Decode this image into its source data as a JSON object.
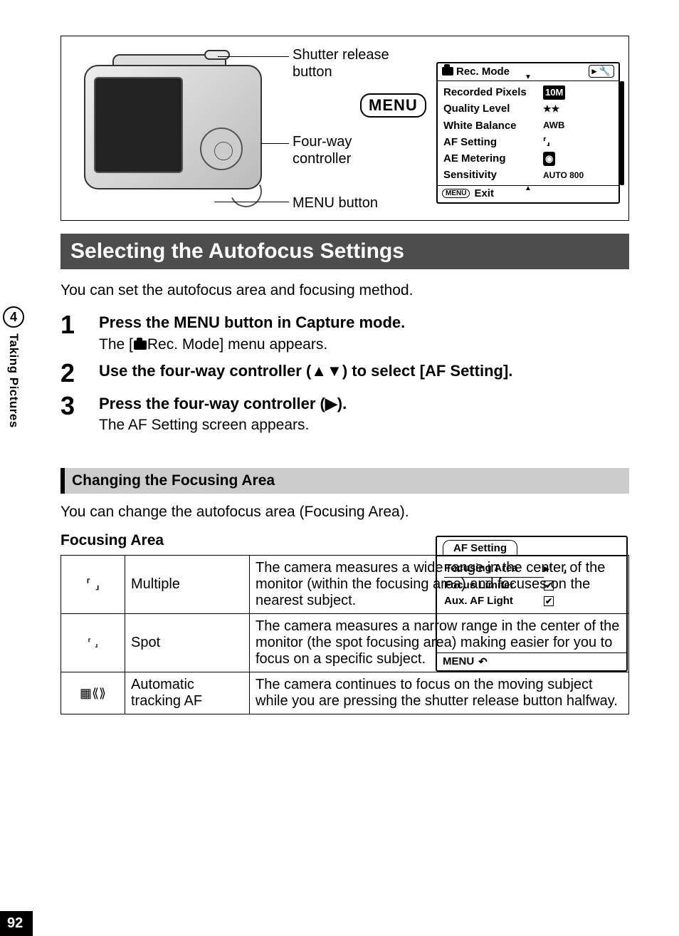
{
  "side": {
    "chapter_num": "4",
    "chapter_title": "Taking Pictures"
  },
  "diagram": {
    "shutter_label": "Shutter release\nbutton",
    "menu_icon": "MENU",
    "fourway_label": "Four-way\ncontroller",
    "menubtn_label": "MENU button"
  },
  "rec_panel": {
    "title": "Rec. Mode",
    "rows": [
      {
        "k": "Recorded Pixels",
        "v": "10M",
        "pill": true
      },
      {
        "k": "Quality Level",
        "v": "★★"
      },
      {
        "k": "White Balance",
        "v": "AWB"
      },
      {
        "k": "AF Setting",
        "v": "⸢  ⸥",
        "icon": true
      },
      {
        "k": "AE Metering",
        "v": "◉",
        "box": true
      },
      {
        "k": "Sensitivity",
        "v": "AUTO 800"
      }
    ],
    "exit_label": "Exit",
    "menu_chip": "MENU"
  },
  "heading": "Selecting the Autofocus Settings",
  "intro": "You can set the autofocus area and focusing method.",
  "steps": [
    {
      "title": "Press the MENU button in Capture mode.",
      "desc_pre": "The [",
      "desc_post": "Rec. Mode] menu appears."
    },
    {
      "title": "Use the four-way controller (▲▼) to select [AF Setting].",
      "desc_pre": "",
      "desc_post": ""
    },
    {
      "title": "Press the four-way controller (▶).",
      "desc_pre": "The AF Setting screen appears.",
      "desc_post": ""
    }
  ],
  "af_panel": {
    "title": "AF Setting",
    "rows": [
      {
        "k": "Focusing Area",
        "sel": true,
        "val_type": "brackets"
      },
      {
        "k": "Focus Limiter",
        "val_type": "check"
      },
      {
        "k": "Aux. AF Light",
        "val_type": "check"
      }
    ],
    "menu_chip": "MENU"
  },
  "sub_heading": "Changing the Focusing Area",
  "sub_intro": "You can change the autofocus area (Focusing Area).",
  "table_title": "Focusing Area",
  "fa_rows": [
    {
      "icon": "⸢    ⸥",
      "name": "Multiple",
      "desc": "The camera measures a wide range in the center of the monitor (within the focusing area) and focuses on the nearest subject."
    },
    {
      "icon": "⸢ ⸥",
      "name": "Spot",
      "desc": "The camera measures a narrow range in the center of the monitor (the spot focusing area) making easier for you to focus on a specific subject."
    },
    {
      "icon": "▦⟪⟫",
      "name": "Automatic tracking AF",
      "desc": "The camera continues to focus on the moving subject while you are pressing the shutter release button halfway."
    }
  ],
  "page_number": "92"
}
